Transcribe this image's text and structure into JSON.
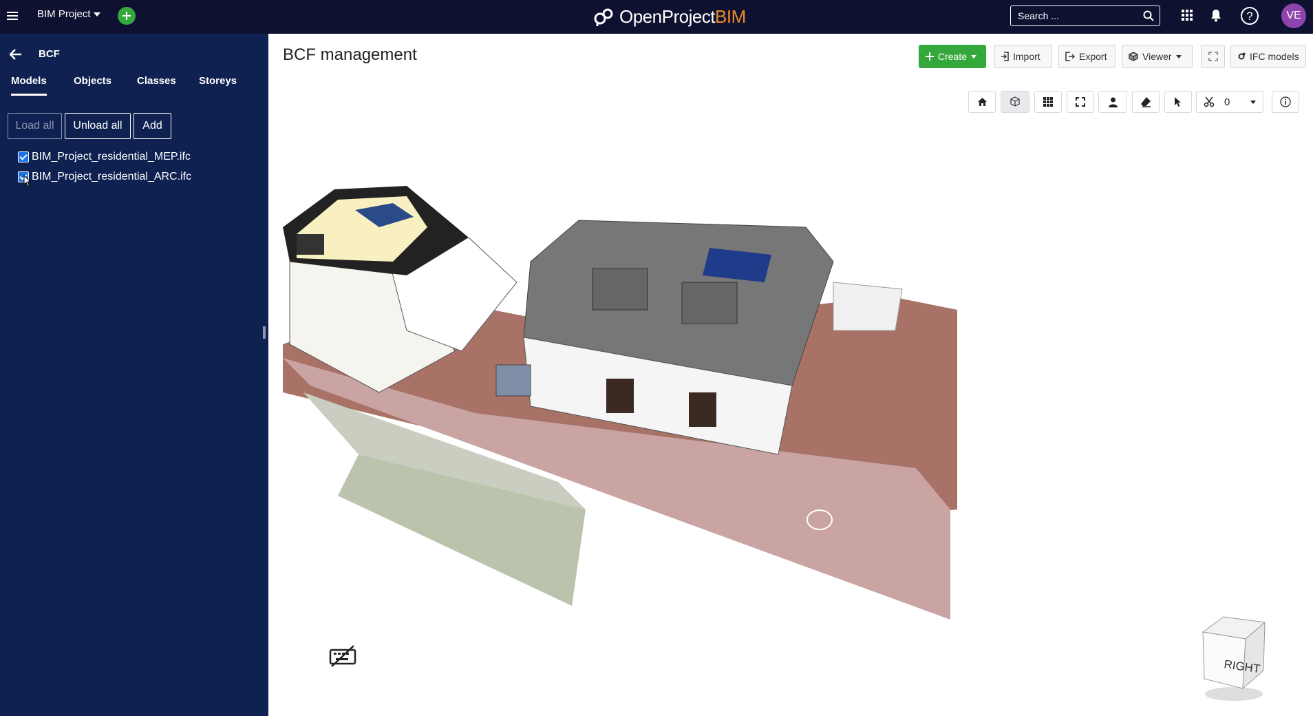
{
  "header": {
    "menu_icon": "hamburger-icon",
    "project_name": "BIM Project",
    "add_icon": "plus-icon",
    "logo_text_main": "OpenProject",
    "logo_text_accent": "BIM",
    "search_placeholder": "Search ...",
    "avatar_initials": "VE",
    "colors": {
      "bar": "#0e1230",
      "add": "#35a83b",
      "avatar": "#8e44ad",
      "logo_accent": "#f08a24"
    }
  },
  "sidebar": {
    "title": "BCF",
    "tabs": [
      {
        "label": "Models",
        "active": true
      },
      {
        "label": "Objects",
        "active": false
      },
      {
        "label": "Classes",
        "active": false
      },
      {
        "label": "Storeys",
        "active": false
      }
    ],
    "buttons": {
      "load_all": "Load all",
      "unload_all": "Unload all",
      "add": "Add"
    },
    "models": [
      {
        "name": "BIM_Project_residential_MEP.ifc",
        "checked": true
      },
      {
        "name": "BIM_Project_residential_ARC.ifc",
        "checked": true
      }
    ],
    "color": "#0e2150"
  },
  "main": {
    "title": "BCF management",
    "toolbar": {
      "create": "Create",
      "import": "Import",
      "export": "Export",
      "viewer": "Viewer",
      "ifc_models": "IFC models"
    },
    "viewer_toolbar": {
      "section_count": "0"
    },
    "navcube_label": "RIGHT"
  }
}
